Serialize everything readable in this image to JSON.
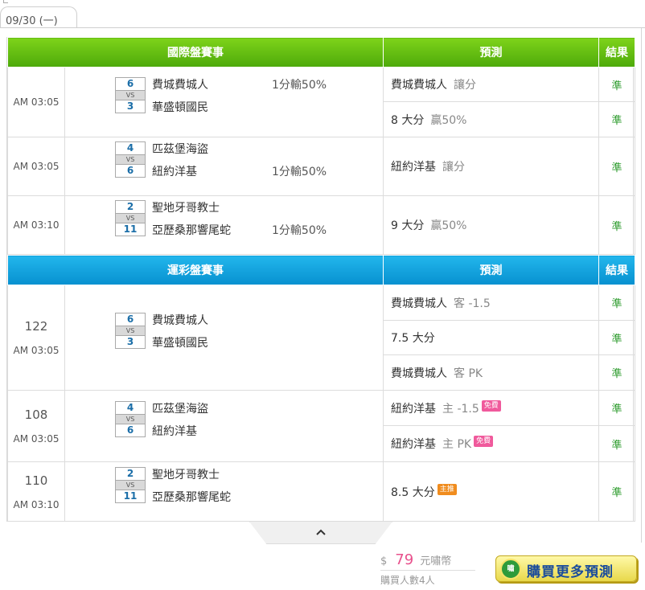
{
  "date_tab": "09/30 (一)",
  "international": {
    "headers": {
      "match": "國際盤賽事",
      "prediction": "預測",
      "result": "結果"
    },
    "games": [
      {
        "time": "AM 03:05",
        "team1": {
          "score": "6",
          "name": "費城費城人"
        },
        "team2": {
          "score": "3",
          "name": "華盛頓國民"
        },
        "handicap": "1分輸50%",
        "handicap_row": 1,
        "predictions": [
          {
            "pick": "費城費城人",
            "detail": "讓分",
            "result": "準"
          },
          {
            "pick": "8 大分",
            "detail": "贏50%",
            "result": "準"
          }
        ]
      },
      {
        "time": "AM 03:05",
        "team1": {
          "score": "4",
          "name": "匹茲堡海盜"
        },
        "team2": {
          "score": "6",
          "name": "紐約洋基"
        },
        "handicap": "1分輸50%",
        "handicap_row": 2,
        "predictions": [
          {
            "pick": "紐約洋基",
            "detail": "讓分",
            "result": "準"
          }
        ]
      },
      {
        "time": "AM 03:10",
        "team1": {
          "score": "2",
          "name": "聖地牙哥教士"
        },
        "team2": {
          "score": "11",
          "name": "亞歷桑那響尾蛇"
        },
        "handicap": "1分輸50%",
        "handicap_row": 2,
        "predictions": [
          {
            "pick": "9 大分",
            "detail": "贏50%",
            "result": "準"
          }
        ]
      }
    ]
  },
  "sports_lottery": {
    "headers": {
      "match": "運彩盤賽事",
      "prediction": "預測",
      "result": "結果"
    },
    "games": [
      {
        "number": "122",
        "time": "AM 03:05",
        "team1": {
          "score": "6",
          "name": "費城費城人"
        },
        "team2": {
          "score": "3",
          "name": "華盛頓國民"
        },
        "predictions": [
          {
            "pick": "費城費城人",
            "detail": "客 -1.5",
            "result": "準"
          },
          {
            "pick": "7.5 大分",
            "detail": "",
            "result": "準"
          },
          {
            "pick": "費城費城人",
            "detail": "客 PK",
            "result": "準"
          }
        ]
      },
      {
        "number": "108",
        "time": "AM 03:05",
        "team1": {
          "score": "4",
          "name": "匹茲堡海盜"
        },
        "team2": {
          "score": "6",
          "name": "紐約洋基"
        },
        "predictions": [
          {
            "pick": "紐約洋基",
            "detail": "主 -1.5",
            "badge": "免費",
            "result": "準"
          },
          {
            "pick": "紐約洋基",
            "detail": "主 PK",
            "badge": "免費",
            "result": "準"
          }
        ]
      },
      {
        "number": "110",
        "time": "AM 03:10",
        "team1": {
          "score": "2",
          "name": "聖地牙哥教士"
        },
        "team2": {
          "score": "11",
          "name": "亞歷桑那響尾蛇"
        },
        "predictions": [
          {
            "pick": "8.5 大分",
            "detail": "",
            "badge": "主推",
            "result": "準"
          }
        ]
      }
    ]
  },
  "collapse_icon": "chevron-up-icon",
  "purchase": {
    "currency_symbol": "$",
    "price": "79",
    "unit": "元嘯幣",
    "buyers": "購買人數4人",
    "logo_text": "嘯",
    "button_label": "購買更多預測"
  },
  "colors": {
    "green_header": "#5cb811",
    "blue_header": "#1aa5e0",
    "result_green": "#2a9a2a",
    "price_pink": "#e8508c",
    "free_badge": "#f05a9c",
    "main_badge": "#f08c1e"
  }
}
